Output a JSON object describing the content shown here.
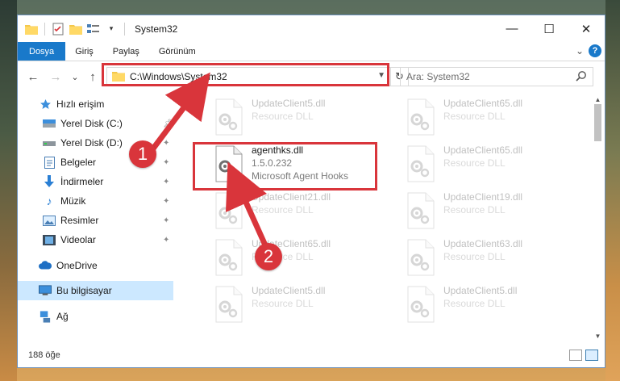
{
  "window": {
    "title": "System32",
    "controls": {
      "minimize": "—",
      "maximize": "☐",
      "close": "✕"
    }
  },
  "ribbon": {
    "tabs": [
      "Dosya",
      "Giriş",
      "Paylaş",
      "Görünüm"
    ],
    "expand_glyph": "⌄",
    "help": "?"
  },
  "nav": {
    "back": "←",
    "forward": "→",
    "recent": "⌄",
    "up": "↑",
    "address": "C:\\Windows\\System32",
    "refresh": "↻",
    "search_placeholder": "Ara: System32"
  },
  "sidebar": {
    "items": [
      {
        "label": "Hızlı erişim",
        "icon": "star-icon"
      },
      {
        "label": "Yerel Disk (C:)",
        "icon": "drive-icon",
        "pinned": true
      },
      {
        "label": "Yerel Disk (D:)",
        "icon": "drive-icon",
        "pinned": true
      },
      {
        "label": "Belgeler",
        "icon": "documents-icon",
        "pinned": true
      },
      {
        "label": "İndirmeler",
        "icon": "download-icon",
        "pinned": true
      },
      {
        "label": "Müzik",
        "icon": "music-icon",
        "pinned": true
      },
      {
        "label": "Resimler",
        "icon": "pictures-icon",
        "pinned": true
      },
      {
        "label": "Videolar",
        "icon": "video-icon",
        "pinned": true
      },
      {
        "label": "OneDrive",
        "icon": "cloud-icon"
      },
      {
        "label": "Bu bilgisayar",
        "icon": "computer-icon",
        "selected": true
      },
      {
        "label": "Ağ",
        "icon": "network-icon"
      }
    ]
  },
  "files": [
    {
      "name": "UpdateClient5.dll",
      "desc": "Resource DLL"
    },
    {
      "name": "UpdateClient65.dll",
      "desc": "Resource DLL"
    },
    {
      "name": "agenthks.dll",
      "version": "1.5.0.232",
      "desc": "Microsoft Agent Hooks",
      "highlight": true
    },
    {
      "name": "UpdateClient65.dll",
      "desc": "Resource DLL"
    },
    {
      "name": "UpdateClient21.dll",
      "desc": "Resource DLL"
    },
    {
      "name": "UpdateClient19.dll",
      "desc": "Resource DLL"
    },
    {
      "name": "UpdateClient65.dll",
      "desc": "Resource DLL"
    },
    {
      "name": "UpdateClient63.dll",
      "desc": "Resource DLL"
    },
    {
      "name": "UpdateClient5.dll",
      "desc": "Resource DLL"
    },
    {
      "name": "UpdateClient5.dll",
      "desc": "Resource DLL"
    }
  ],
  "status": {
    "count": "188 öğe"
  },
  "annotations": {
    "step1": "1",
    "step2": "2",
    "color": "#d9353b"
  },
  "colors": {
    "accent": "#1979ca",
    "selection": "#cce8ff"
  }
}
